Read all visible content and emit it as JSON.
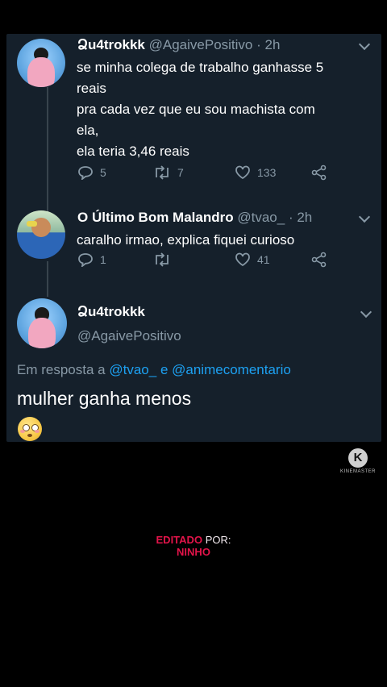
{
  "tweet1": {
    "name": "Ձu4trokkk",
    "handle": "@AgaivePositivo",
    "time": "· 2h",
    "lines": [
      "se minha colega de trabalho ganhasse 5",
      "reais",
      "pra cada vez que eu sou machista com",
      "ela,",
      "ela teria 3,46 reais"
    ],
    "replies": "5",
    "retweets": "7",
    "likes": "133"
  },
  "tweet2": {
    "name": "O Último Bom Malandro",
    "handle": "@tvao_",
    "time": "· 2h",
    "text": "caralho irmao, explica fiquei curioso",
    "replies": "1",
    "retweets": "",
    "likes": "41"
  },
  "tweet3": {
    "name": "Ձu4trokkk",
    "handle": "@AgaivePositivo",
    "reply_prefix": "Em resposta a",
    "reply_user1": "@tvao_",
    "reply_and": "e",
    "reply_user2": "@animecomentario",
    "text": "mulher ganha menos",
    "emoji": "flushed-face-emoji"
  },
  "watermark": {
    "logo": "K",
    "text": "KINEMASTER"
  },
  "credit": {
    "prefix": "EDITADO",
    "por": "POR:",
    "author": "NINHO"
  },
  "colors": {
    "background": "#000000",
    "panel": "#15202b",
    "link": "#1da1f2",
    "muted": "#8899a6",
    "credit_red": "#e3144a"
  }
}
